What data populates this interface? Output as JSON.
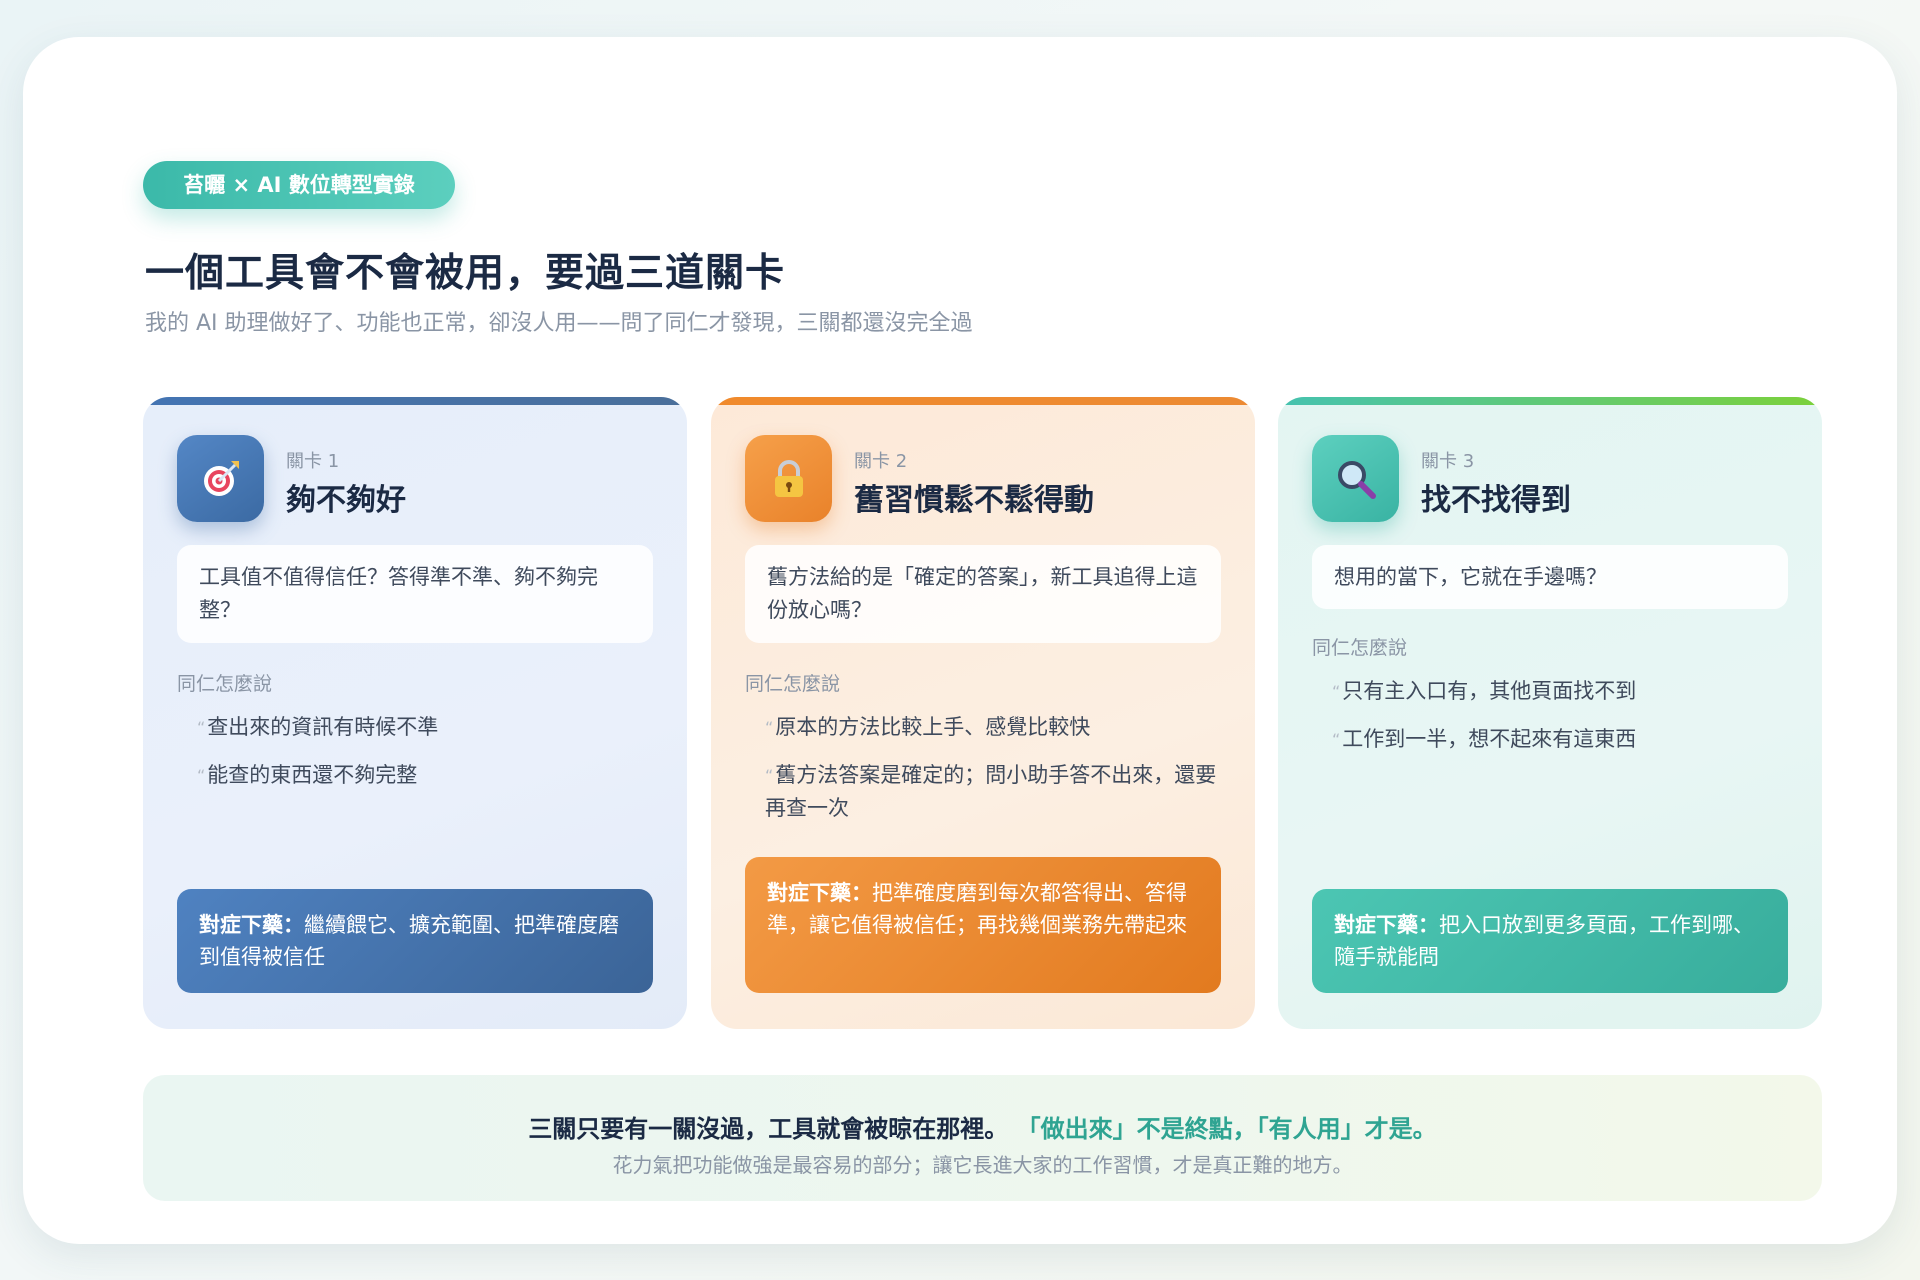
{
  "header": {
    "tag": "苔曬 × AI 數位轉型實錄",
    "title": "一個工具會不會被用，要過三道關卡",
    "subtitle": "我的 AI 助理做好了、功能也正常，卻沒人用——問了同仁才發現，三關都還沒完全過"
  },
  "cards": [
    {
      "level": "關卡 1",
      "name": "夠不夠好",
      "icon": "target-icon",
      "question": "工具值不值得信任？答得準不準、夠不夠完整？",
      "section_label": "同仁怎麼說",
      "quotes": [
        "查出來的資訊有時候不準",
        "能查的東西還不夠完整"
      ],
      "remedy_label": "對症下藥：",
      "remedy": "繼續餵它、擴充範圍、把準確度磨到值得被信任",
      "accent": "#3b6aa3"
    },
    {
      "level": "關卡 2",
      "name": "舊習慣鬆不鬆得動",
      "icon": "lock-icon",
      "question": "舊方法給的是「確定的答案」，新工具追得上這份放心嗎？",
      "section_label": "同仁怎麼說",
      "quotes": [
        "原本的方法比較上手、感覺比較快",
        "舊方法答案是確定的；問小助手答不出來，還要再查一次"
      ],
      "remedy_label": "對症下藥：",
      "remedy": "把準確度磨到每次都答得出、答得準，讓它值得被信任；再找幾個業務先帶起來",
      "accent": "#e9822a"
    },
    {
      "level": "關卡 3",
      "name": "找不找得到",
      "icon": "magnifier-icon",
      "question": "想用的當下，它就在手邊嗎？",
      "section_label": "同仁怎麼說",
      "quotes": [
        "只有主入口有，其他頁面找不到",
        "工作到一半，想不起來有這東西"
      ],
      "remedy_label": "對症下藥：",
      "remedy": "把入口放到更多頁面，工作到哪、隨手就能問",
      "accent": "#39b3a3"
    }
  ],
  "footer": {
    "line1_a": "三關只要有一關沒過，工具就會被晾在那裡。",
    "line1_b": "「做出來」不是終點，「有人用」才是。",
    "line2": "花力氣把功能做強是最容易的部分；讓它長進大家的工作習慣，才是真正難的地方。"
  }
}
